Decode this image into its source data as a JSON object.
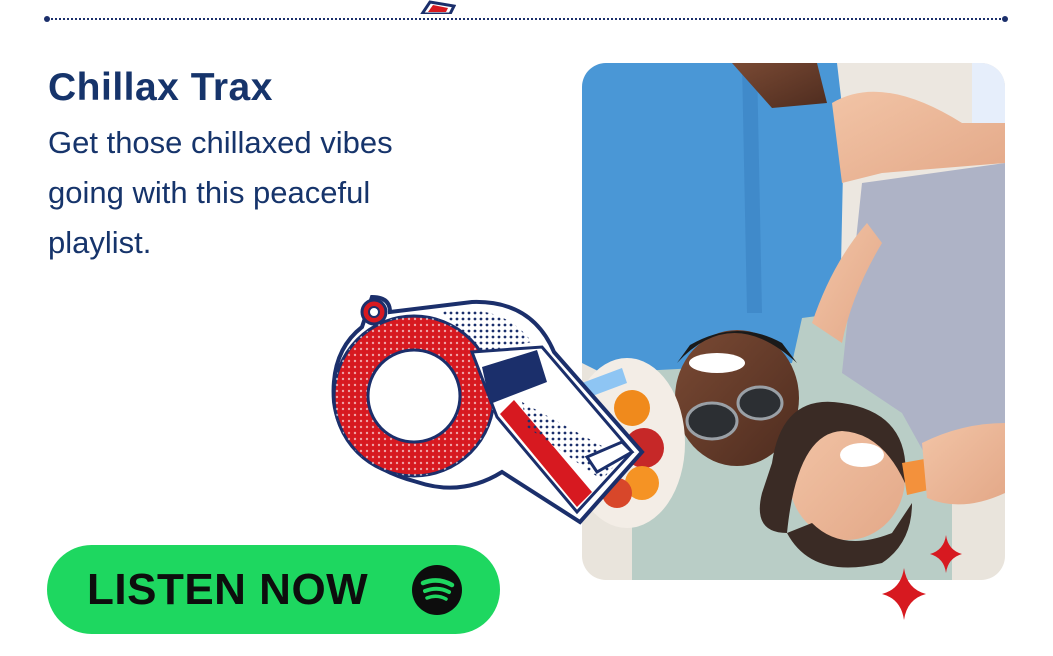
{
  "promo": {
    "title": "Chillax Trax",
    "description": "Get those chillaxed vibes going with this peaceful playlist.",
    "cta_label": "LISTEN NOW"
  },
  "colors": {
    "title_text": "#16346b",
    "cta_background": "#1ed760",
    "cta_text": "#0d0d0d",
    "accent_red": "#d71920",
    "accent_navy": "#1b2f6b"
  },
  "icons": {
    "cta_icon": "spotify-icon",
    "decoration": "whistle-sticker",
    "sparkle": "sparkle-icon"
  }
}
